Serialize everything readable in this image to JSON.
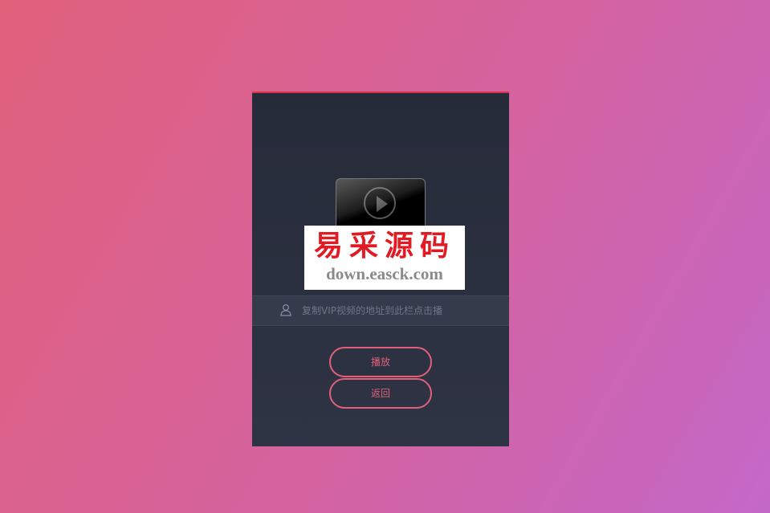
{
  "watermark": {
    "title": "易采源码",
    "url": "down.easck.com"
  },
  "search": {
    "placeholder": "复制VIP视频的地址到此栏点击播"
  },
  "buttons": {
    "play_label": "播放",
    "back_label": "返回"
  },
  "icons": {
    "play": "play-circle-icon",
    "user": "user-icon"
  },
  "colors": {
    "accent": "#e0607a",
    "top_border": "#d8334a",
    "card_bg": "#2a2f3e",
    "watermark_red": "#e01b24"
  }
}
